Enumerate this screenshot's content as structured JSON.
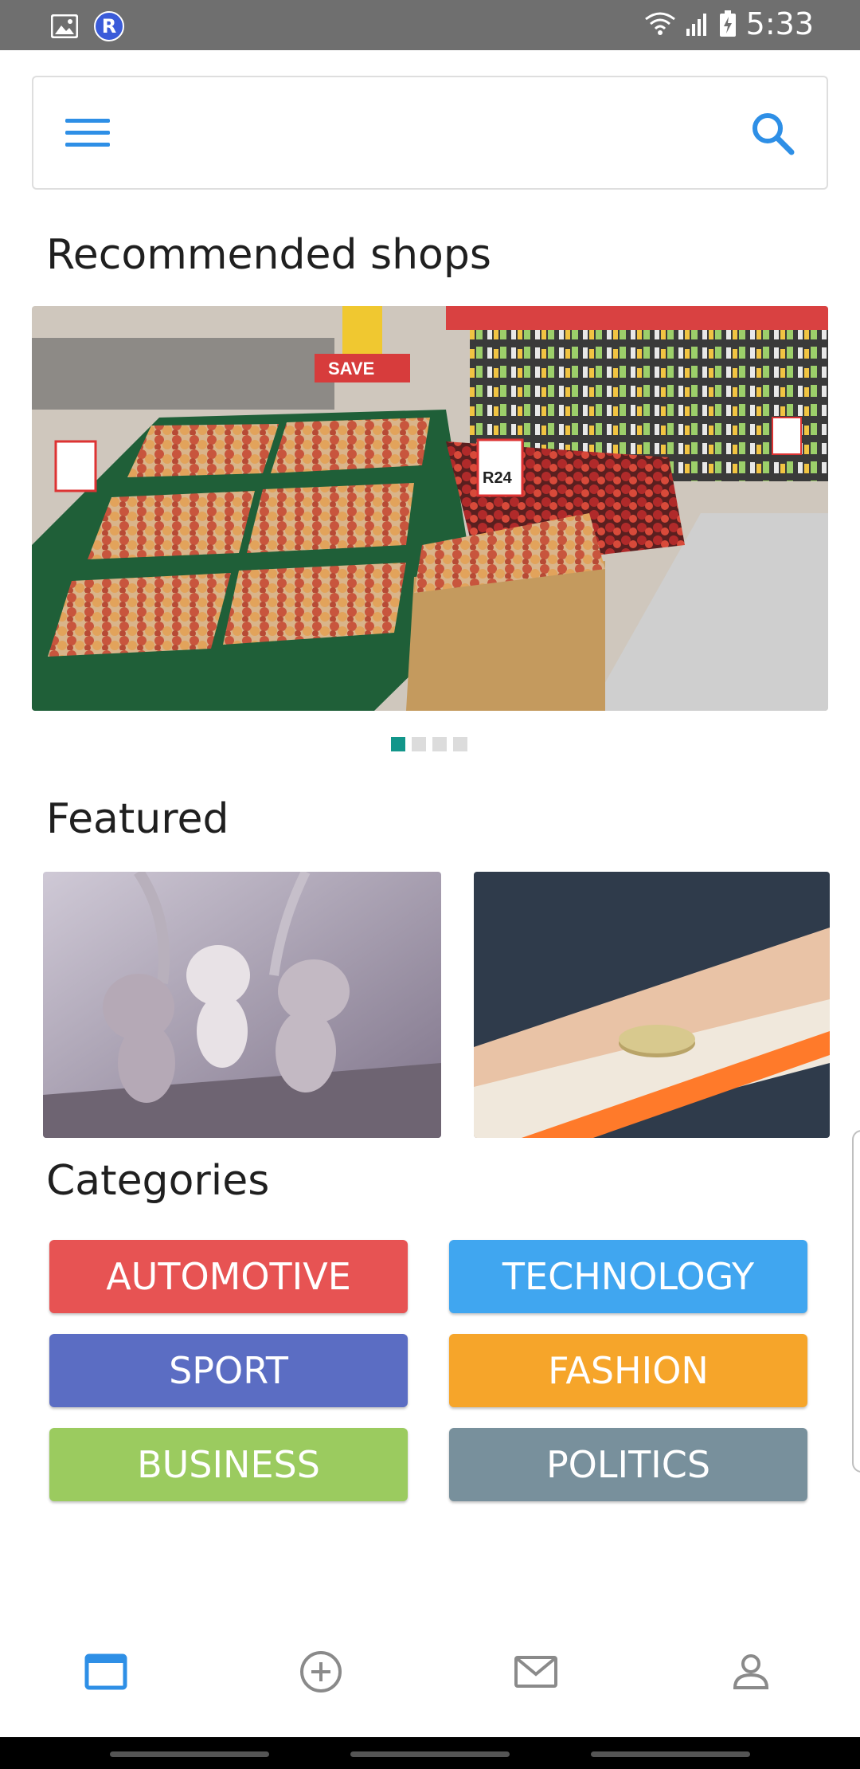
{
  "status_bar": {
    "time": "5:33",
    "left_icons": [
      "image-icon",
      "r-app-icon"
    ],
    "right_icons": [
      "wifi-icon",
      "signal-icon",
      "battery-charging-icon"
    ],
    "r_badge": "R"
  },
  "search_bar": {
    "menu_icon": "menu-icon",
    "search_icon": "search-icon"
  },
  "sections": {
    "recommended": "Recommended shops",
    "featured": "Featured",
    "categories": "Categories"
  },
  "carousel": {
    "total": 4,
    "active_index": 0
  },
  "categories": [
    {
      "label": "AUTOMOTIVE",
      "color": "#e75353"
    },
    {
      "label": "TECHNOLOGY",
      "color": "#40a6f0"
    },
    {
      "label": "SPORT",
      "color": "#5b6dc3"
    },
    {
      "label": "FASHION",
      "color": "#f6a52a"
    },
    {
      "label": "BUSINESS",
      "color": "#9bcb5f"
    },
    {
      "label": "POLITICS",
      "color": "#78909c"
    }
  ],
  "bottom_nav": {
    "items": [
      "browse-icon",
      "add-circle-icon",
      "mail-icon",
      "profile-icon"
    ],
    "active": "browse-icon",
    "active_color": "#2e8fe6",
    "inactive_color": "#8a8a8a"
  }
}
